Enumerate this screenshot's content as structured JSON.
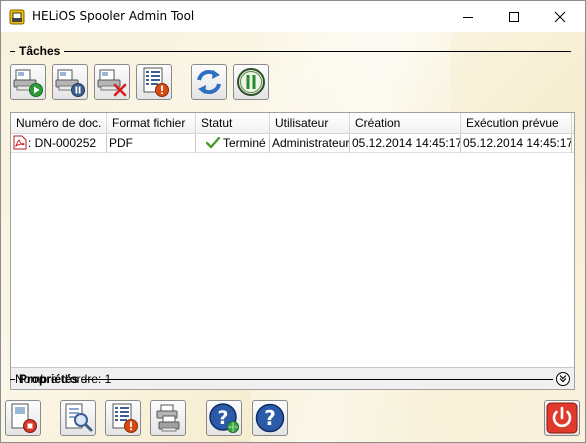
{
  "window": {
    "title": "HELiOS Spooler Admin Tool",
    "accent": "#f7f1dc"
  },
  "tasks_section": {
    "label": "Tâches",
    "toolbar": [
      {
        "name": "start-job-button",
        "icon": "document-play-icon"
      },
      {
        "name": "pause-job-button",
        "icon": "document-pause-icon"
      },
      {
        "name": "delete-job-button",
        "icon": "document-delete-icon"
      },
      {
        "name": "job-error-button",
        "icon": "list-error-icon"
      },
      {
        "name": "refresh-button",
        "icon": "refresh-arrows-icon"
      },
      {
        "name": "pause-spooler-button",
        "icon": "pause-circle-icon"
      }
    ]
  },
  "table": {
    "columns": [
      "Numéro de doc.",
      "Format fichier",
      "Statut",
      "Utilisateur",
      "Création",
      "Exécution prévue"
    ],
    "rows": [
      {
        "doc": ": DN-000252",
        "format": "PDF",
        "status": "Terminé",
        "user": "Administrateur",
        "created": "05.12.2014 14:45:17",
        "scheduled": "05.12.2014 14:45:17"
      }
    ],
    "footer": "Nombre d'ordre: 1"
  },
  "properties_section": {
    "label": "Propriétés"
  },
  "bottom_toolbar": [
    {
      "name": "stop-service-button",
      "icon": "document-stop-icon"
    },
    {
      "name": "search-log-button",
      "icon": "document-search-icon"
    },
    {
      "name": "error-log-button",
      "icon": "list-error-icon"
    },
    {
      "name": "printers-button",
      "icon": "printers-icon"
    },
    {
      "name": "help-online-button",
      "icon": "help-globe-icon"
    },
    {
      "name": "help-button",
      "icon": "help-icon"
    },
    {
      "name": "exit-button",
      "icon": "power-icon"
    }
  ]
}
